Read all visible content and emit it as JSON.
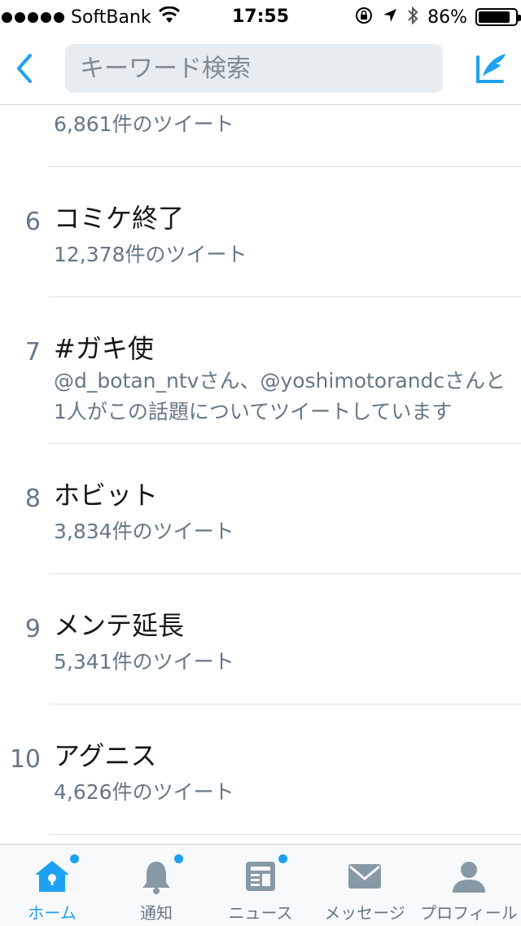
{
  "status_bar": {
    "carrier": "SoftBank",
    "time": "17:55",
    "battery": "86%",
    "battery_level": 0.86
  },
  "nav": {
    "search_placeholder": "キーワード検索",
    "back_icon": "chevron-left-icon",
    "compose_icon": "compose-tweet-icon",
    "accent_color": "#1da1f2"
  },
  "trends": {
    "partial_count": "6,861件のツイート",
    "items": [
      {
        "rank": "6",
        "name": "コミケ終了",
        "count": "12,378件のツイート"
      },
      {
        "rank": "7",
        "name": "#ガキ使",
        "description": "@d_botan_ntvさん、@yoshimotorandcさんと1人がこの話題についてツイートしています"
      },
      {
        "rank": "8",
        "name": "ホビット",
        "count": "3,834件のツイート"
      },
      {
        "rank": "9",
        "name": "メンテ延長",
        "count": "5,341件のツイート"
      },
      {
        "rank": "10",
        "name": "アグニス",
        "count": "4,626件のツイート"
      }
    ]
  },
  "tabs": [
    {
      "label": "ホーム",
      "icon": "home-icon",
      "active": true,
      "badge": true
    },
    {
      "label": "通知",
      "icon": "bell-icon",
      "active": false,
      "badge": true
    },
    {
      "label": "ニュース",
      "icon": "news-icon",
      "active": false,
      "badge": true
    },
    {
      "label": "メッセージ",
      "icon": "envelope-icon",
      "active": false,
      "badge": false
    },
    {
      "label": "プロフィール",
      "icon": "person-icon",
      "active": false,
      "badge": false
    }
  ]
}
